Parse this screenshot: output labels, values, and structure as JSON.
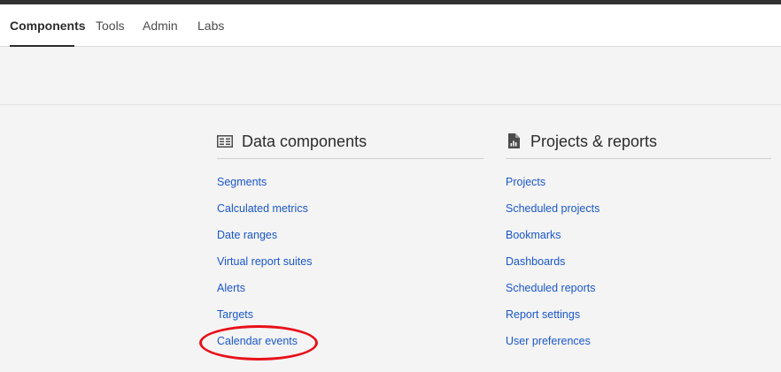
{
  "nav": {
    "tabs": [
      {
        "label": "Components",
        "active": true
      },
      {
        "label": "Tools",
        "active": false
      },
      {
        "label": "Admin",
        "active": false
      },
      {
        "label": "Labs",
        "active": false
      }
    ]
  },
  "data_components": {
    "icon": "data-components-icon",
    "title": "Data components",
    "links": [
      "Segments",
      "Calculated metrics",
      "Date ranges",
      "Virtual report suites",
      "Alerts",
      "Targets",
      "Calendar events"
    ]
  },
  "projects_reports": {
    "icon": "report-document-icon",
    "title": "Projects & reports",
    "links": [
      "Projects",
      "Scheduled projects",
      "Bookmarks",
      "Dashboards",
      "Scheduled reports",
      "Report settings",
      "User preferences"
    ]
  },
  "colors": {
    "link": "#1a57c9",
    "highlight": "#e8101a",
    "topbar": "#323232"
  }
}
